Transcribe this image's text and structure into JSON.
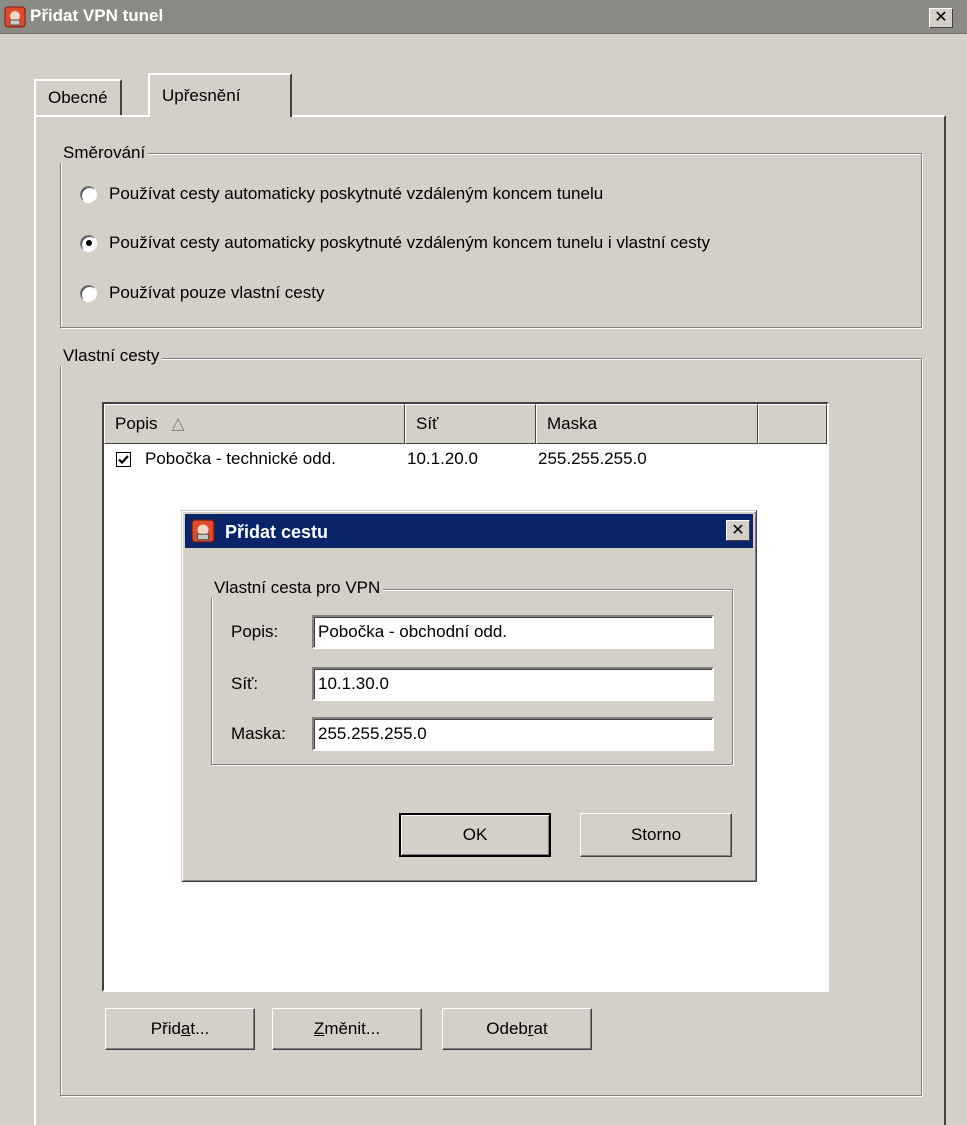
{
  "window": {
    "title": "Přidat VPN tunel",
    "close_glyph": "✕",
    "icon": "vpn-app-icon"
  },
  "tabs": [
    {
      "label": "Obecné",
      "active": false
    },
    {
      "label": "Upřesnění",
      "active": true
    }
  ],
  "routing": {
    "legend": "Směrování",
    "options": [
      {
        "label": "Používat cesty automaticky poskytnuté vzdáleným koncem tunelu",
        "selected": false
      },
      {
        "label": "Používat cesty automaticky poskytnuté vzdáleným koncem tunelu i vlastní cesty",
        "selected": true
      },
      {
        "label": "Používat pouze vlastní cesty",
        "selected": false
      }
    ]
  },
  "custom_routes": {
    "legend": "Vlastní cesty",
    "columns": [
      "Popis",
      "Síť",
      "Maska"
    ],
    "sort_indicator": "△",
    "rows": [
      {
        "checked": true,
        "popis": "Pobočka - technické odd.",
        "sit": "10.1.20.0",
        "maska": "255.255.255.0"
      }
    ],
    "buttons": {
      "add_pre": "Přid",
      "add_key": "a",
      "add_post": "t...",
      "edit_key": "Z",
      "edit_post": "měnit...",
      "remove_pre": "Odeb",
      "remove_key": "r",
      "remove_post": "at"
    }
  },
  "add_route_dialog": {
    "title": "Přidat cestu",
    "close_glyph": "✕",
    "group_legend": "Vlastní cesta pro VPN",
    "fields": {
      "popis_label": "Popis:",
      "popis_value": "Pobočka - obchodní odd.",
      "sit_label": "Síť:",
      "sit_value": "10.1.30.0",
      "maska_label": "Maska:",
      "maska_value": "255.255.255.0"
    },
    "ok_label": "OK",
    "cancel_label": "Storno"
  },
  "colors": {
    "face": "#d4d0c8",
    "titlebar_inactive": "#8c8a85",
    "titlebar_active": "#0a246a"
  }
}
